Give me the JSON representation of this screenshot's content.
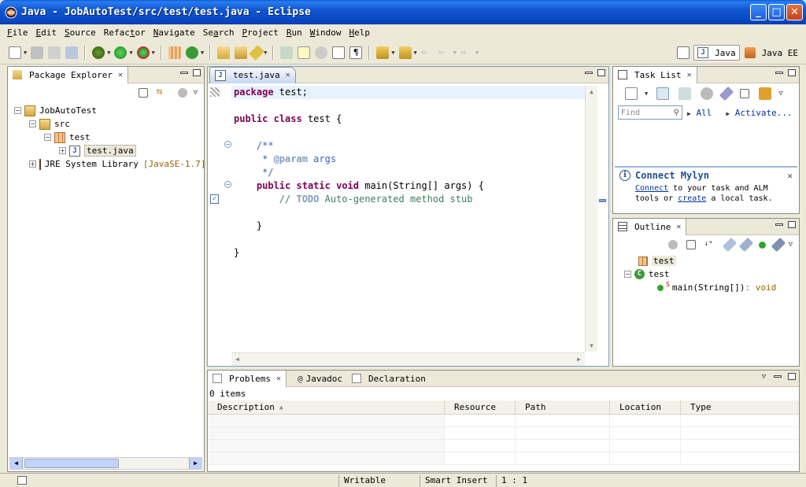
{
  "window": {
    "title": "Java - JobAutoTest/src/test/test.java - Eclipse",
    "minimize_label": "_",
    "maximize_label": "□",
    "close_label": "✕"
  },
  "menu": {
    "items": [
      {
        "u": "F",
        "rest": "ile"
      },
      {
        "u": "E",
        "rest": "dit"
      },
      {
        "u": "S",
        "rest": "ource"
      },
      {
        "u": "",
        "rest": "Refac",
        "u2": "t",
        "rest2": "or"
      },
      {
        "u": "N",
        "rest": "avigate"
      },
      {
        "u": "",
        "rest": "Se",
        "u2": "a",
        "rest2": "rch"
      },
      {
        "u": "P",
        "rest": "roject"
      },
      {
        "u": "R",
        "rest": "un"
      },
      {
        "u": "W",
        "rest": "indow"
      },
      {
        "u": "H",
        "rest": "elp"
      }
    ]
  },
  "perspectives": {
    "java": "Java",
    "javaee": "Java EE"
  },
  "package_explorer": {
    "tab_label": "Package Explorer",
    "tree": {
      "project": "JobAutoTest",
      "src": "src",
      "package": "test",
      "file": "test.java",
      "jre_label": "JRE System Library",
      "jre_version": "[JavaSE-1.7]"
    }
  },
  "editor": {
    "tab_label": "test.java",
    "code": {
      "l1_kw": "package",
      "l1_rest": " test;",
      "l3_kw1": "public",
      "l3_kw2": "class",
      "l3_rest": " test {",
      "l5": "    /**",
      "l6_prefix": "     * ",
      "l6_tag": "@param",
      "l6_rest": " args",
      "l7": "     */",
      "l8_kw1": "public",
      "l8_kw2": "static",
      "l8_kw3": "void",
      "l8_rest": " main(String[] args) {",
      "l9_prefix": "        // ",
      "l9_todo": "TODO",
      "l9_rest": " Auto-generated method stub",
      "l11": "    }",
      "l13": "}"
    }
  },
  "task_list": {
    "tab_label": "Task List",
    "find_placeholder": "Find",
    "all_label": "All",
    "activate_label": "Activate...",
    "mylyn": {
      "title": "Connect Mylyn",
      "connect_link": "Connect",
      "text1": " to your task and ALM",
      "text2": "tools or ",
      "create_link": "create",
      "text3": " a local task."
    }
  },
  "outline": {
    "tab_label": "Outline",
    "package": "test",
    "class": "test",
    "method": "main(String[])",
    "method_return": " : void"
  },
  "bottom": {
    "tabs": {
      "problems": "Problems",
      "javadoc": "Javadoc",
      "declaration": "Declaration"
    },
    "items_count": "0 items",
    "columns": [
      "Description",
      "Resource",
      "Path",
      "Location",
      "Type"
    ]
  },
  "status": {
    "writable": "Writable",
    "insert_mode": "Smart Insert",
    "position": "1 : 1"
  }
}
